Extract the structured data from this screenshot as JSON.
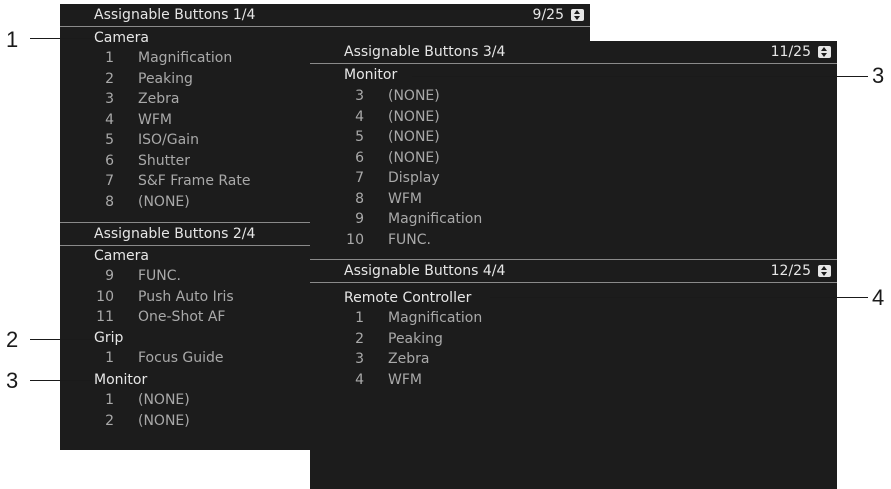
{
  "panel1": {
    "title": "Assignable Buttons 1/4",
    "page": "9/25",
    "category": "Camera",
    "items": [
      {
        "num": "1",
        "label": "Magnification"
      },
      {
        "num": "2",
        "label": "Peaking"
      },
      {
        "num": "3",
        "label": "Zebra"
      },
      {
        "num": "4",
        "label": "WFM"
      },
      {
        "num": "5",
        "label": "ISO/Gain"
      },
      {
        "num": "6",
        "label": "Shutter"
      },
      {
        "num": "7",
        "label": "S&F Frame Rate"
      },
      {
        "num": "8",
        "label": "(NONE)"
      }
    ]
  },
  "panel2": {
    "title": "Assignable Buttons 2/4",
    "camera": {
      "label": "Camera",
      "items": [
        {
          "num": "9",
          "label": "FUNC."
        },
        {
          "num": "10",
          "label": "Push Auto Iris"
        },
        {
          "num": "11",
          "label": "One-Shot AF"
        }
      ]
    },
    "grip": {
      "label": "Grip",
      "items": [
        {
          "num": "1",
          "label": "Focus Guide"
        }
      ]
    },
    "monitor": {
      "label": "Monitor",
      "items": [
        {
          "num": "1",
          "label": "(NONE)"
        },
        {
          "num": "2",
          "label": "(NONE)"
        }
      ]
    }
  },
  "panel3": {
    "title": "Assignable Buttons 3/4",
    "page": "11/25",
    "category": "Monitor",
    "items": [
      {
        "num": "3",
        "label": "(NONE)"
      },
      {
        "num": "4",
        "label": "(NONE)"
      },
      {
        "num": "5",
        "label": "(NONE)"
      },
      {
        "num": "6",
        "label": "(NONE)"
      },
      {
        "num": "7",
        "label": "Display"
      },
      {
        "num": "8",
        "label": "WFM"
      },
      {
        "num": "9",
        "label": "Magnification"
      },
      {
        "num": "10",
        "label": "FUNC."
      }
    ]
  },
  "panel4": {
    "title": "Assignable Buttons 4/4",
    "page": "12/25",
    "category": "Remote Controller",
    "items": [
      {
        "num": "1",
        "label": "Magnification"
      },
      {
        "num": "2",
        "label": "Peaking"
      },
      {
        "num": "3",
        "label": "Zebra"
      },
      {
        "num": "4",
        "label": "WFM"
      }
    ]
  },
  "callouts": {
    "camera": "1",
    "grip": "2",
    "monitor_left": "3",
    "monitor_right": "3",
    "remote": "4"
  },
  "icons": {
    "page_indicator": "up-down-arrows-icon"
  },
  "colors": {
    "panel_bg": "#1c1c1c",
    "heading_text": "#e6e6e6",
    "item_text": "#a9a9a9",
    "divider": "#8a8a8a"
  }
}
